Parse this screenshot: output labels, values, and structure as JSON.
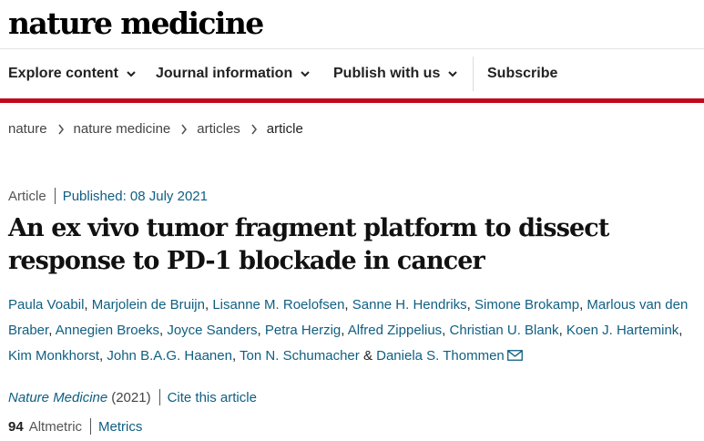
{
  "site": {
    "logo_text": "nature medicine"
  },
  "nav": {
    "items": [
      {
        "label": "Explore content"
      },
      {
        "label": "Journal information"
      },
      {
        "label": "Publish with us"
      }
    ],
    "subscribe_label": "Subscribe"
  },
  "breadcrumb": [
    "nature",
    "nature medicine",
    "articles",
    "article"
  ],
  "article": {
    "type": "Article",
    "published": "Published: 08 July 2021",
    "title": "An ex vivo tumor fragment platform to dissect response to PD-1 blockade in cancer",
    "authors": [
      "Paula Voabil",
      "Marjolein de Bruijn",
      "Lisanne M. Roelofsen",
      "Sanne H. Hendriks",
      "Simone Brokamp",
      "Marlous van den Braber",
      "Annegien Broeks",
      "Joyce Sanders",
      "Petra Herzig",
      "Alfred Zippelius",
      "Christian U. Blank",
      "Koen J. Hartemink",
      "Kim Monkhorst",
      "John B.A.G. Haanen",
      "Ton N. Schumacher",
      "Daniela S. Thommen"
    ],
    "author_separator": ", ",
    "last_author_separator": " & ",
    "journal": "Nature Medicine",
    "year": "(2021)",
    "cite_label": "Cite this article",
    "altmetric_score": "94",
    "altmetric_label": "Altmetric",
    "metrics_label": "Metrics"
  },
  "icons": {
    "nav_chevron": "chevron-down-icon",
    "breadcrumb_sep": "chevron-right-icon",
    "contact": "mail-icon"
  },
  "colors": {
    "accent_red": "#c10a1d",
    "link_blue": "#0f5f82",
    "text": "#222222"
  }
}
